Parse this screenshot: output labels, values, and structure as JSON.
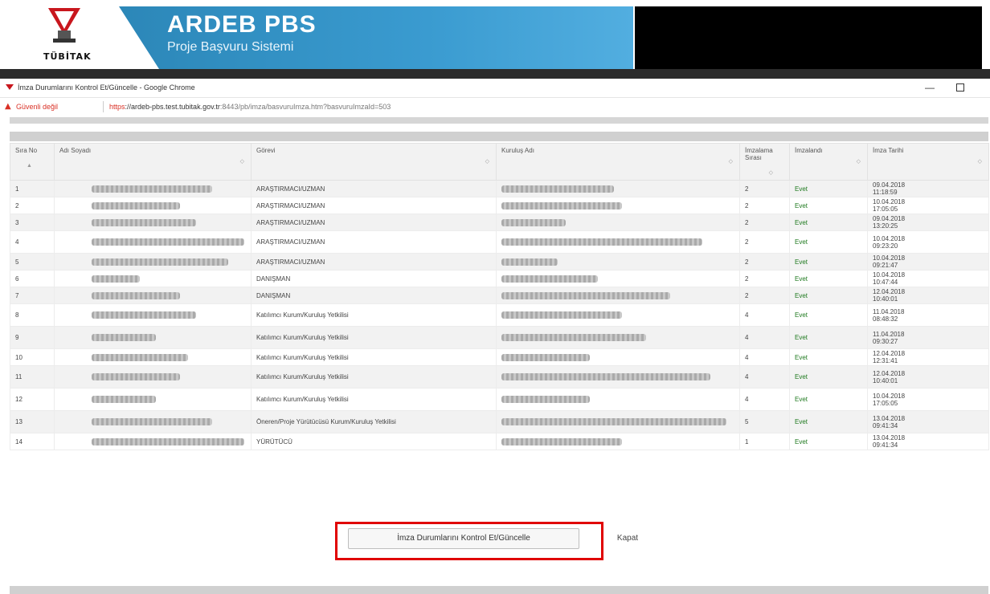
{
  "banner": {
    "logo_text": "TÜBİTAK",
    "title": "ARDEB PBS",
    "subtitle": "Proje Başvuru Sistemi"
  },
  "window": {
    "title": "İmza Durumlarını Kontrol Et/Güncelle - Google Chrome"
  },
  "address_bar": {
    "warning": "Güvenli değil",
    "url_protocol": "https",
    "url_host": "://ardeb-pbs.test.tubitak.gov.tr",
    "url_path": ":8443/pb/imza/basvuruImza.htm?basvuruImzaId=503"
  },
  "table": {
    "headers": {
      "sira_no": "Sıra No",
      "adi_soyadi": "Adı Soyadı",
      "gorevi": "Görevi",
      "kurulus_adi": "Kuruluş Adı",
      "imzalama_sirasi": "İmzalama Sırası",
      "imzalandi": "İmzalandı",
      "imza_tarihi": "İmza Tarihi"
    },
    "rows": [
      {
        "no": "1",
        "gorev": "ARAŞTIRMACI/UZMAN",
        "sira": "2",
        "imzalandi": "Evet",
        "tarih": "09.04.2018",
        "saat": "11:18:59"
      },
      {
        "no": "2",
        "gorev": "ARAŞTIRMACI/UZMAN",
        "sira": "2",
        "imzalandi": "Evet",
        "tarih": "10.04.2018",
        "saat": "17:05:05"
      },
      {
        "no": "3",
        "gorev": "ARAŞTIRMACI/UZMAN",
        "sira": "2",
        "imzalandi": "Evet",
        "tarih": "09.04.2018",
        "saat": "13:20:25"
      },
      {
        "no": "4",
        "gorev": "ARAŞTIRMACI/UZMAN",
        "sira": "2",
        "imzalandi": "Evet",
        "tarih": "10.04.2018",
        "saat": "09:23:20"
      },
      {
        "no": "5",
        "gorev": "ARAŞTIRMACI/UZMAN",
        "sira": "2",
        "imzalandi": "Evet",
        "tarih": "10.04.2018",
        "saat": "09:21:47"
      },
      {
        "no": "6",
        "gorev": "DANIŞMAN",
        "sira": "2",
        "imzalandi": "Evet",
        "tarih": "10.04.2018",
        "saat": "10:47:44"
      },
      {
        "no": "7",
        "gorev": "DANIŞMAN",
        "sira": "2",
        "imzalandi": "Evet",
        "tarih": "12.04.2018",
        "saat": "10:40:01"
      },
      {
        "no": "8",
        "gorev": "Katılımcı Kurum/Kuruluş Yetkilisi",
        "sira": "4",
        "imzalandi": "Evet",
        "tarih": "11.04.2018",
        "saat": "08:48:32"
      },
      {
        "no": "9",
        "gorev": "Katılımcı Kurum/Kuruluş Yetkilisi",
        "sira": "4",
        "imzalandi": "Evet",
        "tarih": "11.04.2018",
        "saat": "09:30:27"
      },
      {
        "no": "10",
        "gorev": "Katılımcı Kurum/Kuruluş Yetkilisi",
        "sira": "4",
        "imzalandi": "Evet",
        "tarih": "12.04.2018",
        "saat": "12:31:41"
      },
      {
        "no": "11",
        "gorev": "Katılımcı Kurum/Kuruluş Yetkilisi",
        "sira": "4",
        "imzalandi": "Evet",
        "tarih": "12.04.2018",
        "saat": "10:40:01"
      },
      {
        "no": "12",
        "gorev": "Katılımcı Kurum/Kuruluş Yetkilisi",
        "sira": "4",
        "imzalandi": "Evet",
        "tarih": "10.04.2018",
        "saat": "17:05:05"
      },
      {
        "no": "13",
        "gorev": "Öneren/Proje Yürütücüsü Kurum/Kuruluş Yetkilisi",
        "sira": "5",
        "imzalandi": "Evet",
        "tarih": "13.04.2018",
        "saat": "09:41:34"
      },
      {
        "no": "14",
        "gorev": "YÜRÜTÜCÜ",
        "sira": "1",
        "imzalandi": "Evet",
        "tarih": "13.04.2018",
        "saat": "09:41:34"
      }
    ]
  },
  "buttons": {
    "check_update": "İmza Durumlarını Kontrol Et/Güncelle",
    "close": "Kapat"
  },
  "colors": {
    "banner_blue": "#3a9bd0",
    "highlight_red": "#e00000",
    "warning_red": "#d93025",
    "evet_green": "#1f7a1f"
  }
}
